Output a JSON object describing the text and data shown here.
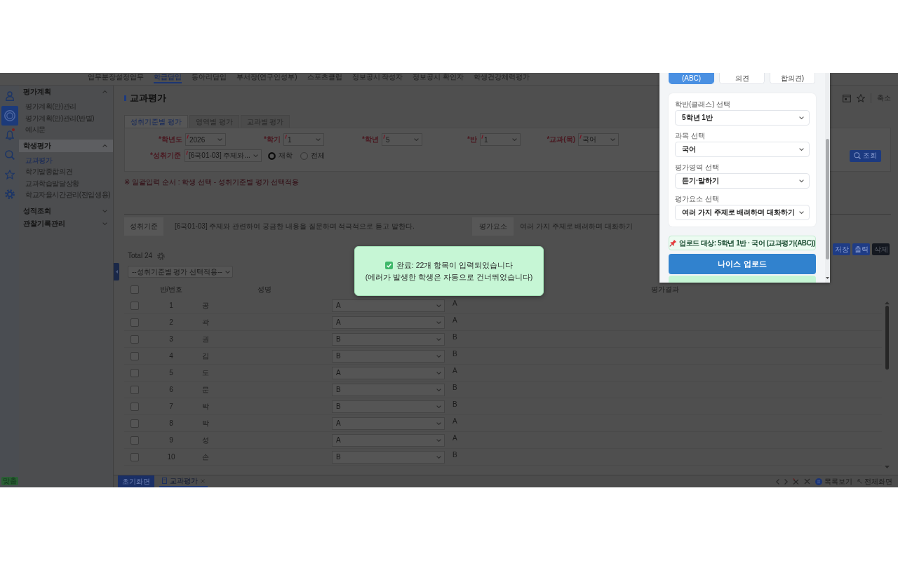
{
  "top_nav": {
    "items": [
      {
        "label": "업무분장설정업무",
        "selected": false
      },
      {
        "label": "학급담임",
        "selected": true
      },
      {
        "label": "동아리담임",
        "selected": false
      },
      {
        "label": "부서장(연구인성부)",
        "selected": false
      },
      {
        "label": "스포츠클럽",
        "selected": false
      },
      {
        "label": "정보공시 작성자",
        "selected": false
      },
      {
        "label": "정보공시 확인자",
        "selected": false
      },
      {
        "label": "학생건강체력평가",
        "selected": false
      }
    ]
  },
  "icon_rail": {
    "items": [
      {
        "selected": false,
        "alert": false
      },
      {
        "selected": true,
        "alert": false
      },
      {
        "selected": false,
        "alert": true
      },
      {
        "selected": false,
        "alert": false
      },
      {
        "selected": false,
        "alert": false
      },
      {
        "selected": false,
        "alert": false
      }
    ],
    "bottom_button": "맞춤"
  },
  "sidebar": {
    "sections": [
      {
        "label": "평가계획",
        "selected": false,
        "expanded": true,
        "items": [
          {
            "label": "평가계획(안)관리",
            "selected": false
          },
          {
            "label": "평가계획(안)관리(반별)",
            "selected": false
          },
          {
            "label": "예시문",
            "selected": false
          }
        ]
      },
      {
        "label": "학생평가",
        "selected": true,
        "expanded": true,
        "items": [
          {
            "label": "교과평가",
            "selected": true
          },
          {
            "label": "학기말종합의견",
            "selected": false
          },
          {
            "label": "교과학습발달상황",
            "selected": false
          },
          {
            "label": "학교자율시간관리(전입생용)",
            "selected": false
          }
        ]
      },
      {
        "label": "성적조회",
        "selected": false,
        "expanded": false
      },
      {
        "label": "관찰기록관리",
        "selected": false,
        "expanded": false
      }
    ]
  },
  "page": {
    "title": "교과평가",
    "collapse_button": "축소"
  },
  "tabs": [
    {
      "label": "성취기준별 평가",
      "selected": true
    },
    {
      "label": "영역별 평가",
      "selected": false
    },
    {
      "label": "교과별 평가",
      "selected": false
    }
  ],
  "filters": {
    "fields": [
      {
        "label": "*학년도",
        "value": "2026",
        "required": true
      },
      {
        "label": "*학기",
        "value": "1",
        "required": true
      },
      {
        "label": "*학년",
        "value": "5",
        "required": true
      },
      {
        "label": "*반",
        "value": "1",
        "required": true
      },
      {
        "label": "*교과(목)",
        "value": "국어",
        "required": true
      }
    ],
    "standard": {
      "label": "*성취기준",
      "value": "[6국01-03] 주제와...",
      "required": true
    },
    "radios": [
      {
        "label": "재학",
        "selected": true
      },
      {
        "label": "전체",
        "selected": false
      }
    ],
    "search_button": "조회"
  },
  "notice": "※ 일괄입력 순서 : 학생 선택 - 성취기준별 평가 선택적용",
  "standard_info": {
    "standard_label": "성취기준",
    "standard": "[6국01-03] 주제와 관련하여 궁금한 내용을 질문하며 적극적으로 듣고 말한다.",
    "element_label": "평가요소",
    "element": "여러 가지 주제로 배려하며 대화하기"
  },
  "grid": {
    "total": "Total 24",
    "buttons": [
      {
        "label": "저장",
        "kind": "primary"
      },
      {
        "label": "출력",
        "kind": "primary"
      },
      {
        "label": "삭제",
        "kind": "dark"
      }
    ],
    "bulk_select": "--성취기준별 평가 선택적용--",
    "header_checked": false,
    "columns": [
      "반/번호",
      "성명",
      "평가결과"
    ],
    "rows": [
      {
        "checked": false,
        "number": "1",
        "name": "공",
        "grade": "A",
        "result": "A"
      },
      {
        "checked": false,
        "number": "2",
        "name": "곽",
        "grade": "A",
        "result": "A"
      },
      {
        "checked": false,
        "number": "3",
        "name": "권",
        "grade": "B",
        "result": "B"
      },
      {
        "checked": false,
        "number": "4",
        "name": "김",
        "grade": "B",
        "result": "B"
      },
      {
        "checked": false,
        "number": "5",
        "name": "도",
        "grade": "A",
        "result": "A"
      },
      {
        "checked": false,
        "number": "6",
        "name": "문",
        "grade": "B",
        "result": "B"
      },
      {
        "checked": false,
        "number": "7",
        "name": "박",
        "grade": "B",
        "result": "B"
      },
      {
        "checked": false,
        "number": "8",
        "name": "박",
        "grade": "A",
        "result": "A"
      },
      {
        "checked": false,
        "number": "9",
        "name": "성",
        "grade": "A",
        "result": "A"
      },
      {
        "checked": false,
        "number": "10",
        "name": "손",
        "grade": "B",
        "result": "B"
      }
    ]
  },
  "bottom_bar": {
    "home_button": "초기화면",
    "tabs": [
      {
        "label": "교과평가",
        "selected": true
      }
    ],
    "list_button": "목록보기",
    "fullscreen_button": "전체화면"
  },
  "upload_panel": {
    "type_buttons": [
      {
        "label": "(ABC)",
        "selected": true
      },
      {
        "label": "의견",
        "selected": false
      },
      {
        "label": "합의견)",
        "selected": false
      }
    ],
    "fields": [
      {
        "label": "학반(클래스) 선택",
        "value": "5학년 1반"
      },
      {
        "label": "과목 선택",
        "value": "국어"
      },
      {
        "label": "평가영역 선택",
        "value": "듣기·말하기"
      },
      {
        "label": "평가요소 선택",
        "value": "여러 가지 주제로 배려하며 대화하기"
      }
    ],
    "target": "업로드 대상: 5학년 1반 · 국어 (교과평가(ABC))",
    "upload_button": "나이스 업로드"
  },
  "toast": {
    "title": "완료: 22개 항목이 입력되었습니다",
    "message": "(에러가 발생한 학생은 자동으로 건너뛰었습니다)"
  }
}
